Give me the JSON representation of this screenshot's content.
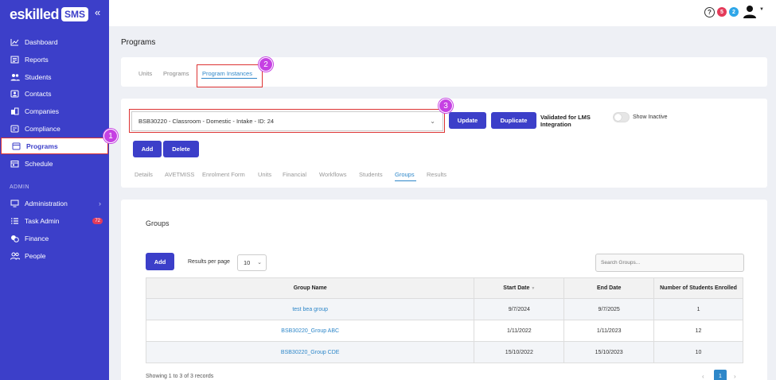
{
  "brand": {
    "name": "eskilled",
    "product": "SMS"
  },
  "sidebar": {
    "items": [
      {
        "label": "Dashboard",
        "icon": "chart-line-icon"
      },
      {
        "label": "Reports",
        "icon": "report-icon"
      },
      {
        "label": "Students",
        "icon": "users-icon"
      },
      {
        "label": "Contacts",
        "icon": "contacts-icon"
      },
      {
        "label": "Companies",
        "icon": "building-icon"
      },
      {
        "label": "Compliance",
        "icon": "compliance-icon"
      },
      {
        "label": "Programs",
        "icon": "programs-icon"
      },
      {
        "label": "Schedule",
        "icon": "calendar-icon"
      }
    ],
    "section_label": "ADMIN",
    "admin_items": [
      {
        "label": "Administration",
        "icon": "admin-icon"
      },
      {
        "label": "Task Admin",
        "icon": "task-list-icon",
        "badge": "72"
      },
      {
        "label": "Finance",
        "icon": "coins-icon"
      },
      {
        "label": "People",
        "icon": "people-icon"
      }
    ]
  },
  "topbar": {
    "help": "?",
    "notif_red": "5",
    "notif_blue": "2"
  },
  "page": {
    "title": "Programs"
  },
  "tabs": {
    "units": "Units",
    "programs": "Programs",
    "instances": "Program Instances"
  },
  "callouts": {
    "one": "1",
    "two": "2",
    "three": "3"
  },
  "instance": {
    "selected": "BSB30220 - Classroom - Domestic - Intake - ID: 24",
    "update": "Update",
    "duplicate": "Duplicate",
    "validated": "Validated for LMS Integration",
    "show_inactive": "Show Inactive",
    "add": "Add",
    "delete": "Delete"
  },
  "subtabs": [
    "Details",
    "AVETMISS",
    "Enrolment Form",
    "Units",
    "Financial",
    "Workflows",
    "Students",
    "Groups",
    "Results"
  ],
  "groups": {
    "title": "Groups",
    "add": "Add",
    "rpp_label": "Results per page",
    "rpp_value": "10",
    "search_placeholder": "Search Groups...",
    "columns": [
      "Group Name",
      "Start Date",
      "End Date",
      "Number of Students Enrolled"
    ],
    "rows": [
      [
        "test bea group",
        "9/7/2024",
        "9/7/2025",
        "1"
      ],
      [
        "BSB30220_Group ABC",
        "1/11/2022",
        "1/11/2023",
        "12"
      ],
      [
        "BSB30220_Group CDE",
        "15/10/2022",
        "15/10/2023",
        "10"
      ]
    ],
    "showing": "Showing 1 to 3 of 3 records",
    "page": "1"
  },
  "colors": {
    "sidebar": "#3c3fc9",
    "accent_link": "#2e87c9",
    "highlight_box": "#dd3333",
    "callout": "#c641e3"
  }
}
